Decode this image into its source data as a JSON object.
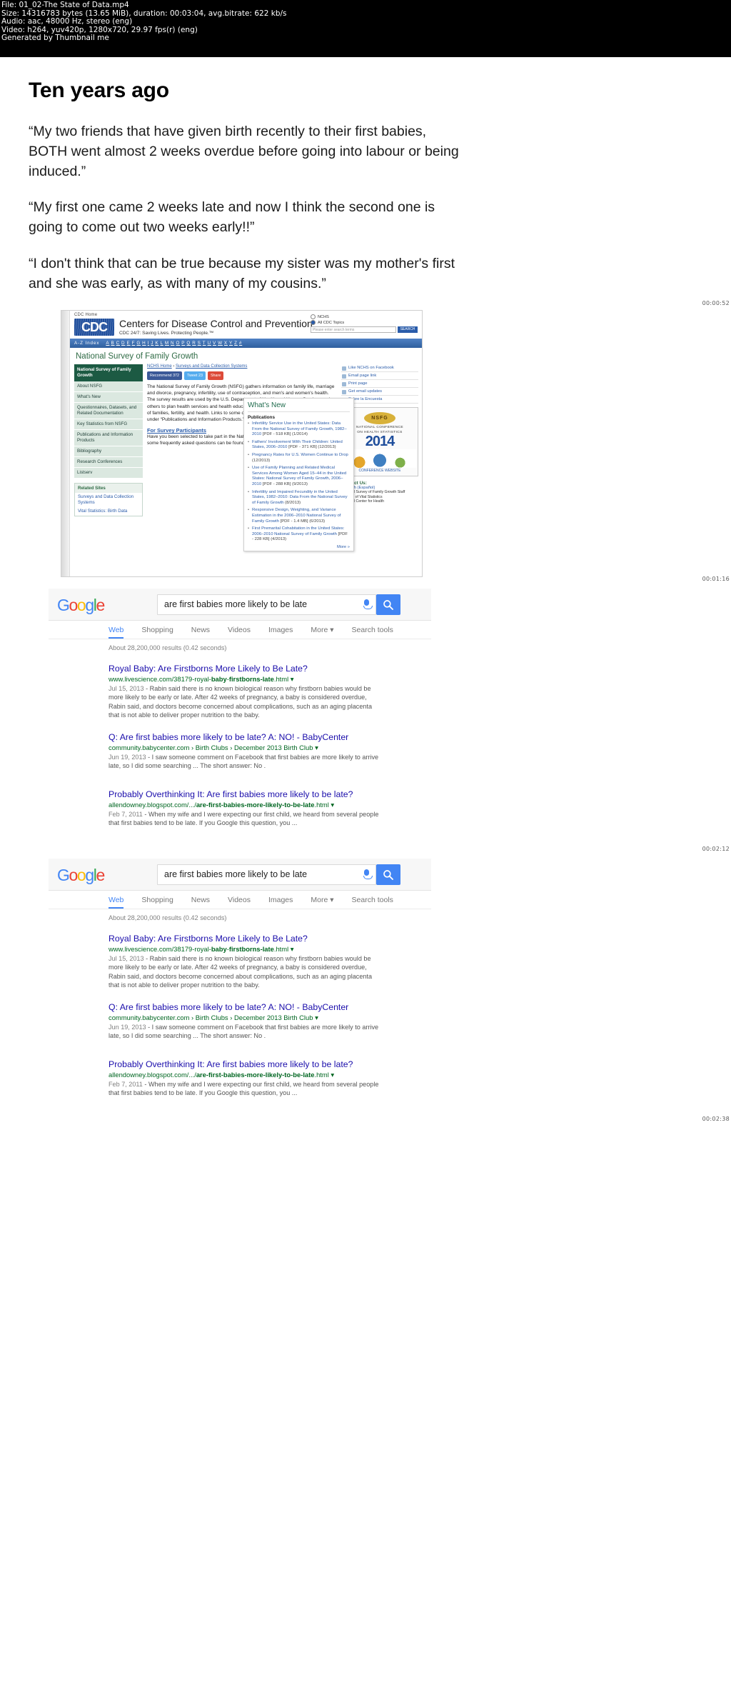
{
  "metadata": {
    "file_line": "File: 01_02-The State of Data.mp4",
    "size_line": "Size: 14316783 bytes (13.65 MiB), duration: 00:03:04, avg.bitrate: 622 kb/s",
    "audio_line": "Audio: aac, 48000 Hz, stereo (eng)",
    "video_line": "Video: h264, yuv420p, 1280x720, 29.97 fps(r) (eng)",
    "generator_line": "Generated by Thumbnail me"
  },
  "slide": {
    "title": "Ten years ago",
    "quotes": [
      "“My two friends that have given birth recently to their first babies, BOTH went almost 2 weeks overdue before going into labour or being induced.”",
      "“My first one came 2 weeks late and now I think the second one is going to come out two weeks early!!”",
      "“I don't think that can be true because my sister was my mother's first and she was early, as with many of my cousins.”"
    ],
    "timestamp": "00:00:52"
  },
  "cdc": {
    "timestamp": "00:01:16",
    "home_link": "CDC Home",
    "logo_text": "CDC",
    "brand_title": "Centers for Disease Control and Prevention",
    "brand_tagline": "CDC 24/7: Saving Lives. Protecting People.™",
    "search": {
      "option_nchs": "NCHS",
      "option_all": "All CDC Topics",
      "placeholder": "Please enter search terms",
      "button_label": "SEARCH"
    },
    "az_label": "A-Z Index",
    "az_letters": [
      "A",
      "B",
      "C",
      "D",
      "E",
      "F",
      "G",
      "H",
      "I",
      "J",
      "K",
      "L",
      "M",
      "N",
      "O",
      "P",
      "Q",
      "R",
      "S",
      "T",
      "U",
      "V",
      "W",
      "X",
      "Y",
      "Z",
      "#"
    ],
    "page_heading": "National Survey of Family Growth",
    "breadcrumb_home": "NCHS Home",
    "breadcrumb_sep": "›",
    "breadcrumb_current": "Surveys and Data Collection Systems",
    "social": [
      {
        "label": "Recommend",
        "count": "372"
      },
      {
        "label": "Tweet",
        "count": "23"
      },
      {
        "label": "Share",
        "count": ""
      }
    ],
    "nav_header": "National Survey of Family Growth",
    "nav_items": [
      "About NSFG",
      "What's New",
      "Questionnaires, Datasets, and Related Documentation",
      "Key Statistics from NSFG",
      "Publications and Information Products",
      "Bibliography",
      "Research Conferences",
      "Listserv"
    ],
    "related_header": "Related Sites",
    "related_items": [
      "Surveys and Data Collection Systems",
      "Vital Statistics: Birth Data"
    ],
    "body_paragraph": "The National Survey of Family Growth (NSFG) gathers information on family life, marriage and divorce, pregnancy, infertility, use of contraception, and men's and women's health. The survey results are used by the U.S. Department of Health and Human Services and others to plan health services and health education programs, and to do statistical studies of families, fertility, and health. Links to some of those studies are included on this web site, under “Publications and Information Products.”",
    "body_link": "Publications and Information Products",
    "survey_heading": "For Survey Participants",
    "survey_text": "Have you been selected to take part in the National Survey of Family Growth? Answers to some frequently asked questions can be found here.",
    "right_buttons": [
      "Like NCHS on Facebook",
      "Email page link",
      "Print page",
      "Get email updates",
      "Sobre la Encuesta"
    ],
    "contact_label": "Contact Us:",
    "contact_link": "Spanish (Español)",
    "contact_lines": [
      "National Survey of Family Growth Staff",
      "Division of Vital Statistics",
      "National Center for Health"
    ],
    "conf": {
      "badge": "NSFG",
      "line1": "NATIONAL CONFERENCE",
      "line2": "ON HEALTH STATISTICS",
      "year": "2014",
      "website": "CONFERENCE WEBSITE"
    },
    "whats_new": {
      "title": "What's New",
      "section": "Publications",
      "items": [
        {
          "text": "Infertility Service Use in the United States: Data From the National Survey of Family Growth, 1982–2010",
          "meta": "PDF - 518 KB",
          "date": "(1/2014)"
        },
        {
          "text": "Fathers' Involvement With Their Children: United States, 2006–2010",
          "meta": "PDF - 371 KB",
          "date": "(12/2013)"
        },
        {
          "text": "Pregnancy Rates for U.S. Women Continue to Drop",
          "meta": "",
          "date": "(12/2013)"
        },
        {
          "text": "Use of Family Planning and Related Medical Services Among Women Aged 15–44 in the United States: National Survey of Family Growth, 2006–2010",
          "meta": "PDF - 288 KB",
          "date": "(9/2013)"
        },
        {
          "text": "Infertility and Impaired Fecundity in the United States, 1982–2010: Data From the National Survey of Family Growth",
          "meta": "",
          "date": "(8/2013)"
        },
        {
          "text": "Responsive Design, Weighting, and Variance Estimation in the 2006–2010 National Survey of Family Growth",
          "meta": "PDF - 1.4 MB",
          "date": "(6/2013)"
        },
        {
          "text": "First Premarital Cohabitation in the United States: 2006–2010 National Survey of Family Growth",
          "meta": "PDF - 228 KB",
          "date": "(4/2013)"
        }
      ],
      "more": "More »"
    }
  },
  "google": {
    "logo_letters": [
      {
        "ch": "G",
        "color": "blue"
      },
      {
        "ch": "o",
        "color": "red"
      },
      {
        "ch": "o",
        "color": "yellow"
      },
      {
        "ch": "g",
        "color": "blue"
      },
      {
        "ch": "l",
        "color": "green"
      },
      {
        "ch": "e",
        "color": "red"
      }
    ],
    "query": "are first babies more likely to be late",
    "tabs": [
      "Web",
      "Shopping",
      "News",
      "Videos",
      "Images",
      "More",
      "Search tools"
    ],
    "selected_tab": "Web",
    "stats": "About 28,200,000 results (0.42 seconds)",
    "results": [
      {
        "title": "Royal Baby: Are Firstborns More Likely to Be Late?",
        "url_prefix": "www.livescience.com/38179-royal-",
        "url_bold1": "baby",
        "url_mid": "-",
        "url_bold2": "firstborns-late",
        "url_suffix": ".html",
        "date": "Jul 15, 2013",
        "snippet": "Rabin said there is no known biological reason why firstborn babies would be more likely to be early or late. After 42 weeks of pregnancy, a baby is considered overdue, Rabin said, and doctors become concerned about complications, such as an aging placenta that is not able to deliver proper nutrition to the baby."
      },
      {
        "title": "Q: Are first babies more likely to be late? A: NO! - BabyCenter",
        "url_prefix": "community.babycenter.com",
        "url_crumb1": "Birth Clubs",
        "url_crumb2": "December 2013 Birth Club",
        "date": "Jun 19, 2013",
        "snippet": "I saw someone comment on Facebook that first babies are more likely to arrive late, so I did some searching ... The short answer: No ."
      },
      {
        "title": "Probably Overthinking It: Are first babies more likely to be late?",
        "url_prefix": "allendowney.blogspot.com/.../",
        "url_bold1": "are-first-babies-more-likely-to-be-late",
        "url_suffix": ".html",
        "date": "Feb 7, 2011",
        "snippet": "When my wife and I were expecting our first child, we heard from several people that first babies tend to be late. If you Google this question, you ..."
      }
    ],
    "timestamp_first": "00:02:12",
    "timestamp_second": "00:02:38"
  }
}
